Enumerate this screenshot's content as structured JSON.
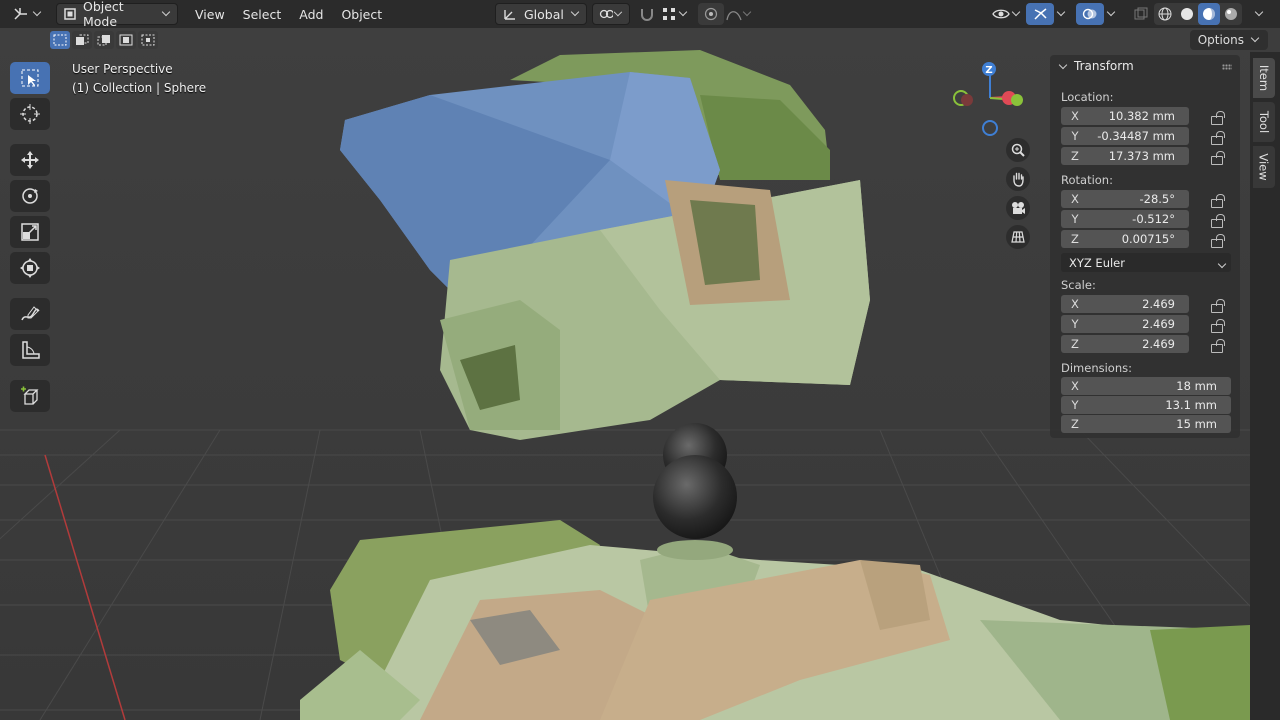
{
  "header": {
    "mode_label": "Object Mode",
    "menus": [
      "View",
      "Select",
      "Add",
      "Object"
    ],
    "orientation_label": "Global"
  },
  "subbar": {
    "options_label": "Options"
  },
  "viewport": {
    "perspective_text": "User Perspective",
    "collection_text": "(1) Collection | Sphere",
    "gizmo_z_label": "Z"
  },
  "npanel": {
    "title": "Transform",
    "location_label": "Location:",
    "location": [
      {
        "axis": "X",
        "value": "10.382 mm"
      },
      {
        "axis": "Y",
        "value": "-0.34487 mm"
      },
      {
        "axis": "Z",
        "value": "17.373 mm"
      }
    ],
    "rotation_label": "Rotation:",
    "rotation": [
      {
        "axis": "X",
        "value": "-28.5°"
      },
      {
        "axis": "Y",
        "value": "-0.512°"
      },
      {
        "axis": "Z",
        "value": "0.00715°"
      }
    ],
    "rotation_mode": "XYZ Euler",
    "scale_label": "Scale:",
    "scale": [
      {
        "axis": "X",
        "value": "2.469"
      },
      {
        "axis": "Y",
        "value": "2.469"
      },
      {
        "axis": "Z",
        "value": "2.469"
      }
    ],
    "dimensions_label": "Dimensions:",
    "dimensions": [
      {
        "axis": "X",
        "value": "18 mm"
      },
      {
        "axis": "Y",
        "value": "13.1 mm"
      },
      {
        "axis": "Z",
        "value": "15 mm"
      }
    ]
  },
  "sidetabs": [
    "Item",
    "Tool",
    "View"
  ],
  "colors": {
    "accent": "#4772b3",
    "axis_x": "#e04a56",
    "axis_y": "#8ac23a",
    "axis_z": "#3f7fd4",
    "model_green": "#8fa678",
    "model_blue": "#6e8fbe",
    "model_tan": "#b79f7c"
  },
  "icons": {
    "editor_type": "axes-editor-icon",
    "tools": [
      "select-box-icon",
      "cursor-icon",
      "move-icon",
      "rotate-icon",
      "scale-icon",
      "transform-icon",
      "annotate-icon",
      "measure-icon",
      "add-cube-icon"
    ],
    "nav": [
      "zoom-icon",
      "hand-pan-icon",
      "camera-icon",
      "grid-ortho-icon"
    ]
  }
}
